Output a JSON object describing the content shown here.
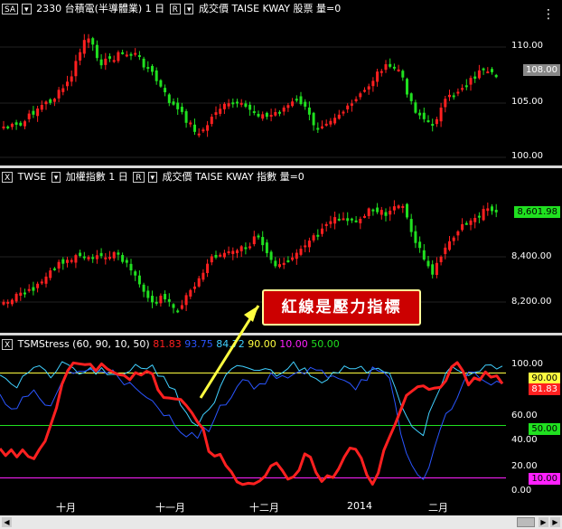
{
  "pane1": {
    "symbol": "SA",
    "code": "2330",
    "name": "台積電(半導體業)",
    "period": "1 日",
    "r_label": "R",
    "source": "成交價 TAISE KWAY 股票",
    "vol": "量=0",
    "axis": [
      "110.00",
      "105.00",
      "100.00"
    ],
    "last": "108.00",
    "menu_icon": "⋮"
  },
  "pane2": {
    "close": "X",
    "code": "TWSE",
    "name": "加權指數",
    "period": "1 日",
    "r_label": "R",
    "source": "成交價 TAISE KWAY 指數",
    "vol": "量=0",
    "axis": [
      "8,400.00",
      "8,200.00"
    ],
    "last": "8,601.98"
  },
  "pane3": {
    "close": "X",
    "name": "TSMStress",
    "params": "(60, 90, 10, 50)",
    "v1": "81.83",
    "v2": "93.75",
    "v3": "84.72",
    "v4": "90.00",
    "v5": "10.00",
    "v6": "50.00",
    "axis": [
      "100.00",
      "60.00",
      "40.00",
      "20.00",
      "0.00"
    ],
    "tag_81": "81.83",
    "tag_90": "90.00",
    "tag_50": "50.00",
    "tag_10": "10.00"
  },
  "x_labels": [
    "十月",
    "十一月",
    "十二月",
    "2014",
    "二月"
  ],
  "callout": "紅線是壓力指標",
  "colors": {
    "up": "#ff2020",
    "down": "#20e020",
    "stress": "#ff2020",
    "blue": "#2a55ff",
    "cyan": "#40d0ff",
    "yellow": "#ffff40",
    "green": "#20e020",
    "magenta": "#ff20ff"
  }
}
